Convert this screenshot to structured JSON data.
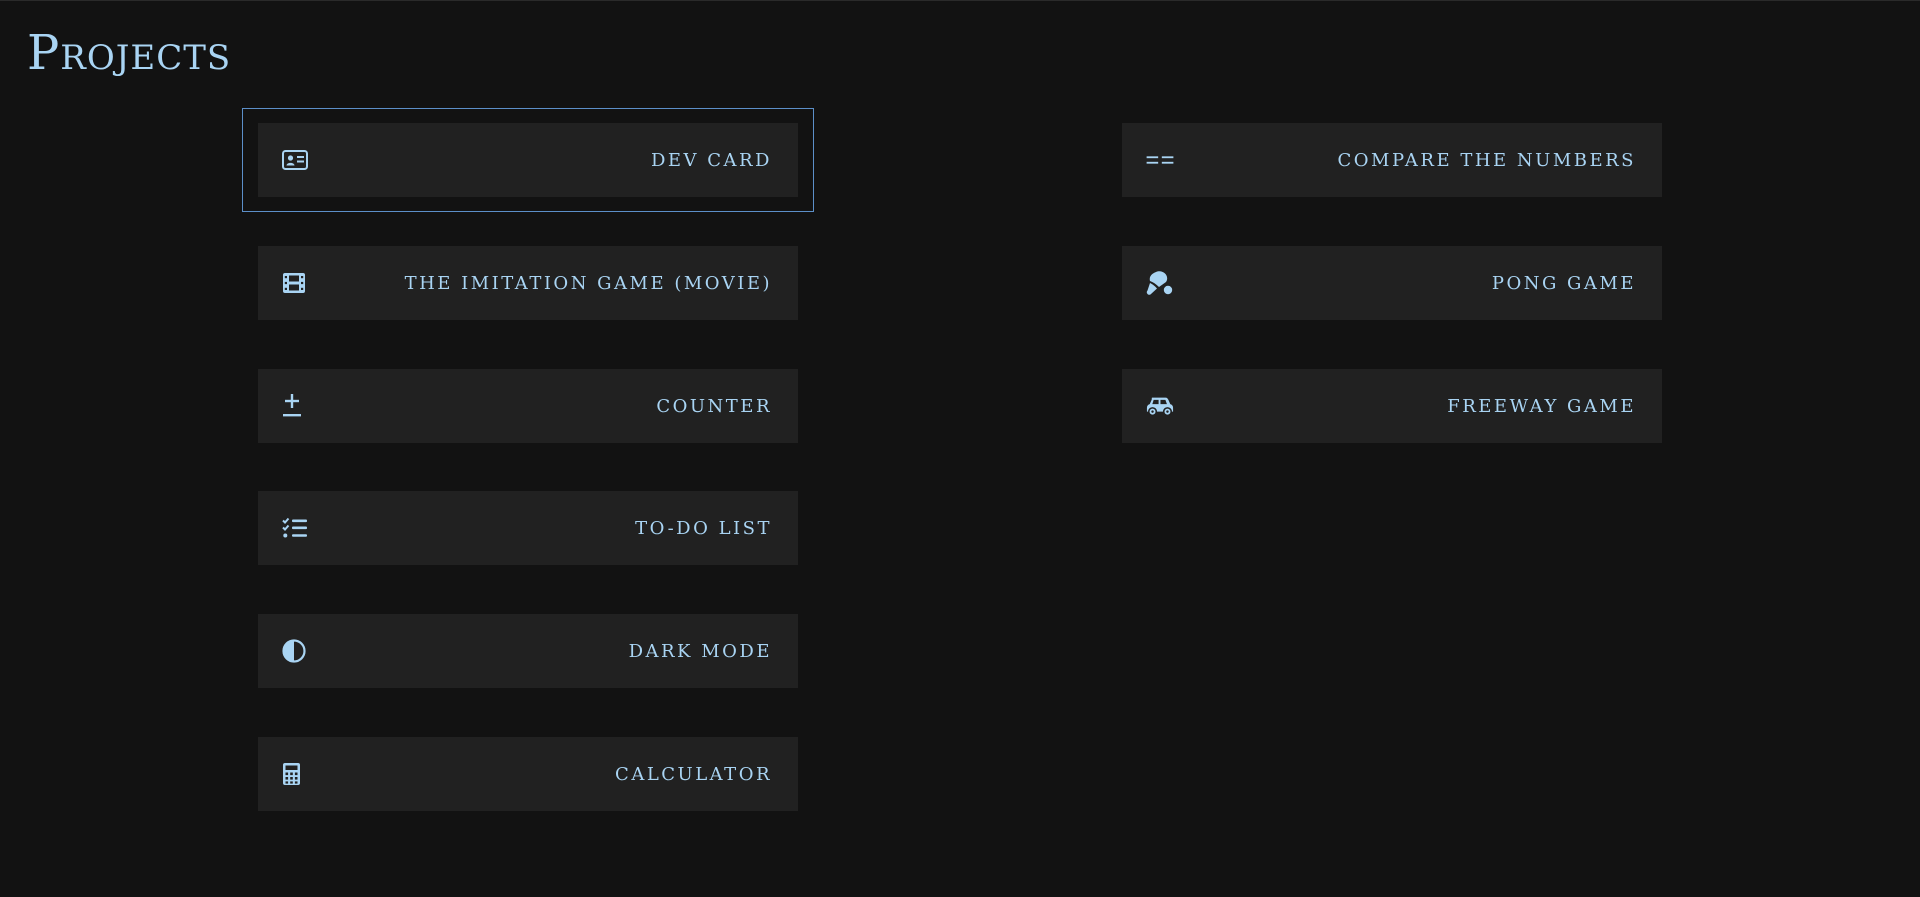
{
  "page": {
    "title": "Projects"
  },
  "colors": {
    "background": "#121212",
    "card": "#212121",
    "accent": "#a9d4f3",
    "focus_outline": "#5c8fc8"
  },
  "projects": {
    "left": [
      {
        "label": "Dev Card",
        "icon": "id-card-icon"
      },
      {
        "label": "The Imitation Game (movie)",
        "icon": "film-icon"
      },
      {
        "label": "Counter",
        "icon": "plus-minus-icon"
      },
      {
        "label": "To-Do List",
        "icon": "checklist-icon"
      },
      {
        "label": "Dark Mode",
        "icon": "contrast-icon"
      },
      {
        "label": "Calculator",
        "icon": "calculator-icon"
      }
    ],
    "right": [
      {
        "label": "Compare the Numbers",
        "icon": "equals-icon"
      },
      {
        "label": "Pong Game",
        "icon": "table-tennis-icon"
      },
      {
        "label": "Freeway Game",
        "icon": "car-icon"
      }
    ]
  }
}
